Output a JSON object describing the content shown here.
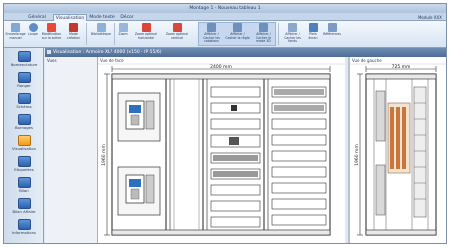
{
  "window": {
    "title": "Montage 1 - Nouveau tableau 1"
  },
  "tabs": [
    {
      "label": "Général"
    },
    {
      "label": "Visualisation",
      "active": true
    },
    {
      "label": "Mode texte"
    },
    {
      "label": "Décor"
    }
  ],
  "module_label": "Module XXX",
  "ribbon": {
    "buttons": [
      {
        "label": "Encombrage manuel",
        "icon": "ruler-icon"
      },
      {
        "label": "Loupe",
        "icon": "magnifier-icon"
      },
      {
        "label": "Modification sur la scène",
        "icon": "wand-icon"
      },
      {
        "label": "Mode création",
        "icon": "pencil-icon"
      },
      {
        "label": "Bibliothèque",
        "icon": "library-icon"
      },
      {
        "label": "Zoom",
        "icon": "zoom-icon"
      },
      {
        "label": "Zoom optimal horizontal",
        "icon": "zoom-horizontal-icon"
      },
      {
        "label": "Zoom optimal vertical",
        "icon": "zoom-vertical-icon"
      },
      {
        "label": "Afficher / Cacher les cotations",
        "icon": "dimensions-icon"
      },
      {
        "label": "Afficher / Cacher la règle",
        "icon": "ruler-show-icon"
      },
      {
        "label": "Afficher / Cacher le mode 3D",
        "icon": "cube-3d-icon"
      },
      {
        "label": "Afficher / Cacher les fonds",
        "icon": "background-icon"
      },
      {
        "label": "Plein écran",
        "icon": "fullscreen-icon"
      },
      {
        "label": "Références",
        "icon": "references-icon"
      }
    ]
  },
  "nav": [
    {
      "label": "Nomenclature",
      "icon": "list-icon"
    },
    {
      "label": "Ranger",
      "icon": "cabinet-icon"
    },
    {
      "label": "Schéma",
      "icon": "schema-icon"
    },
    {
      "label": "Bornages",
      "icon": "terminal-icon"
    },
    {
      "label": "Visualisation",
      "icon": "eye-icon",
      "active": true
    },
    {
      "label": "Etiquettes",
      "icon": "label-icon"
    },
    {
      "label": "Bilan",
      "icon": "report-icon"
    },
    {
      "label": "Bilan Affaire",
      "icon": "report-folder-icon"
    },
    {
      "label": "Informations",
      "icon": "info-icon"
    }
  ],
  "view_header": "Visualisation : Armoire XL³ 4000 (x150 - IP 55/6)",
  "panels": {
    "views_title": "Vues",
    "front": {
      "title": "Vue de face",
      "width_dim": "2400 mm",
      "height_dim": "1960 mm"
    },
    "left": {
      "title": "Vue de gauche",
      "width_dim": "725 mm",
      "height_dim": "1960 mm"
    }
  }
}
